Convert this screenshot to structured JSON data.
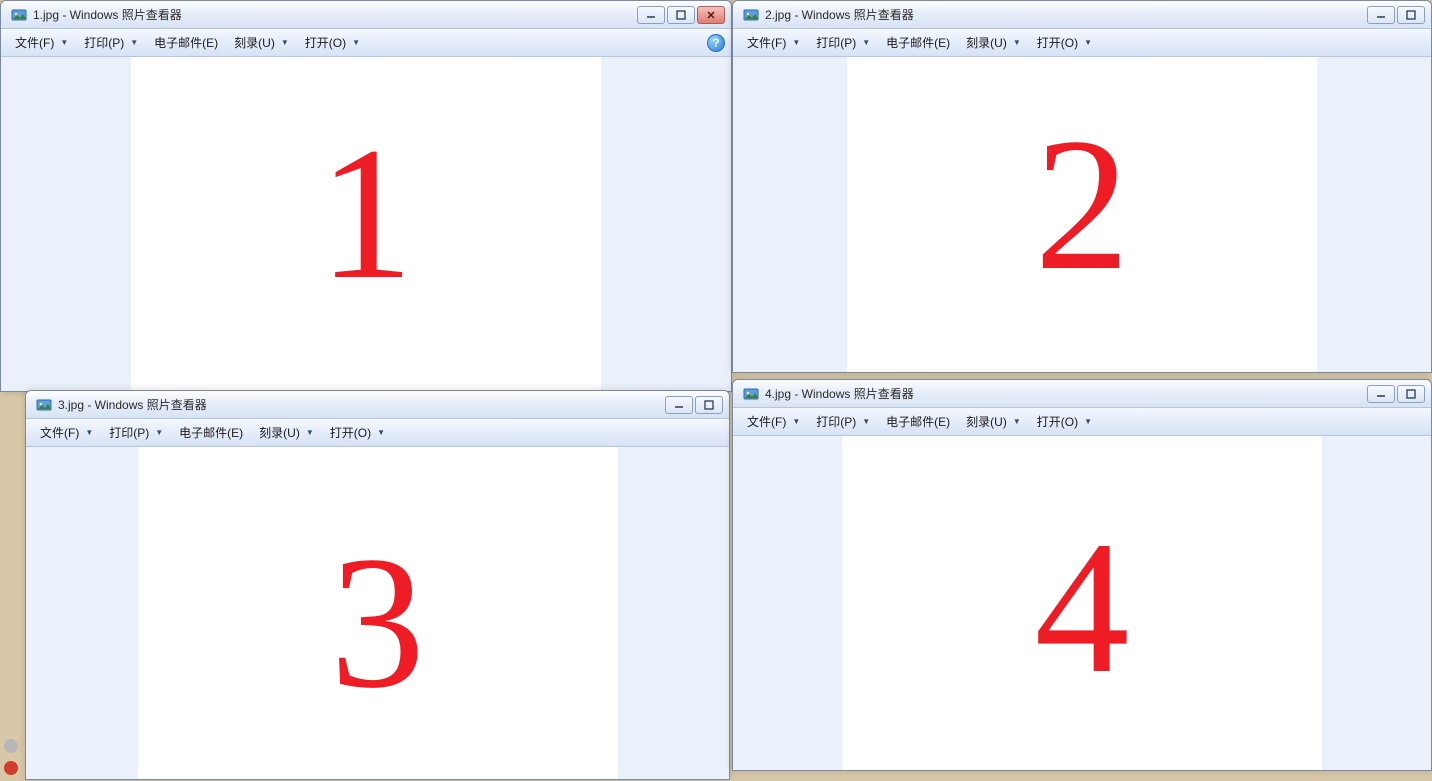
{
  "app_name": "Windows 照片查看器",
  "menu": {
    "file": "文件(F)",
    "print": "打印(P)",
    "email": "电子邮件(E)",
    "burn": "刻录(U)",
    "open": "打开(O)"
  },
  "windows": [
    {
      "filename": "1.jpg",
      "title": "1.jpg - Windows 照片查看器",
      "content": "1"
    },
    {
      "filename": "2.jpg",
      "title": "2.jpg - Windows 照片查看器",
      "content": "2"
    },
    {
      "filename": "3.jpg",
      "title": "3.jpg - Windows 照片查看器",
      "content": "3"
    },
    {
      "filename": "4.jpg",
      "title": "4.jpg - Windows 照片查看器",
      "content": "4"
    }
  ],
  "help_glyph": "?",
  "dropdown_glyph": "▼"
}
